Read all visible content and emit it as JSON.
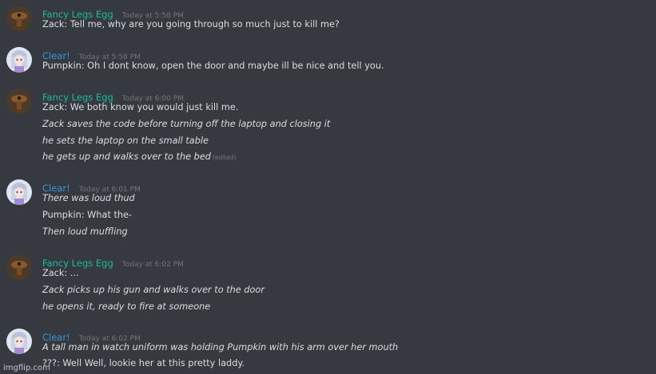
{
  "colors": {
    "background": "#36393f",
    "fancy_name": "#1abc9c",
    "clear_name": "#3498db",
    "text": "#dcddde",
    "timestamp": "#72767d"
  },
  "messages": [
    {
      "author": "Fancy Legs Egg",
      "timestamp": "Today at 5:58 PM",
      "avatar_icon": "fancy-avatar-icon",
      "lines": [
        "Zack: Tell me, why are you going through so much just to kill me?"
      ]
    },
    {
      "author": "Clear!",
      "timestamp": "Today at 5:58 PM",
      "avatar_icon": "clear-avatar-icon",
      "lines": [
        "Pumpkin: Oh I dont know, open the door and maybe ill be nice and tell you."
      ]
    },
    {
      "author": "Fancy Legs Egg",
      "timestamp": "Today at 6:00 PM",
      "avatar_icon": "fancy-avatar-icon",
      "lines": [
        "Zack: We both know you would just kill me.",
        "Zack saves the code before turning off the laptop and closing it",
        "he sets the laptop on the small table",
        "he gets up and walks over to the bed"
      ],
      "edited_label": "(edited)"
    },
    {
      "author": "Clear!",
      "timestamp": "Today at 6:01 PM",
      "avatar_icon": "clear-avatar-icon",
      "lines": [
        "There was loud thud",
        "Pumpkin: What the-",
        "Then loud muffling"
      ]
    },
    {
      "author": "Fancy Legs Egg",
      "timestamp": "Today at 6:02 PM",
      "avatar_icon": "fancy-avatar-icon",
      "lines": [
        "Zack: ...",
        "Zack picks up his gun and walks over to the door",
        "he opens it, ready to fire at someone"
      ]
    },
    {
      "author": "Clear!",
      "timestamp": "Today at 6:02 PM",
      "avatar_icon": "clear-avatar-icon",
      "lines": [
        "A tall man in watch uniform was holding Pumpkin with his arm over her mouth",
        "???: Well Well, lookie her at this pretty laddy."
      ]
    }
  ],
  "watermark": "imgflip.com"
}
